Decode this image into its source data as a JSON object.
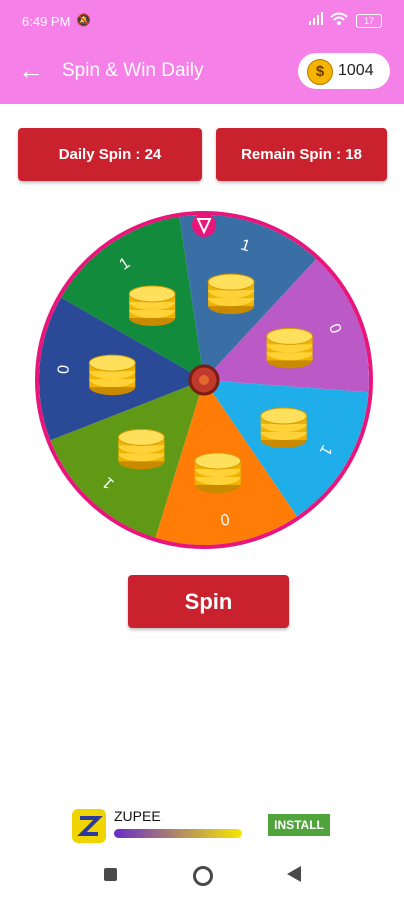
{
  "status_bar": {
    "time": "6:49 PM",
    "battery": "17"
  },
  "app_bar": {
    "title": "Spin & Win Daily",
    "coin_symbol": "$",
    "coins": "1004"
  },
  "stats": {
    "daily": "Daily Spin : 24",
    "remain": "Remain Spin : 18"
  },
  "wheel": {
    "segments": [
      {
        "label": "1",
        "color": "#128c3c"
      },
      {
        "label": "1",
        "color": "#3a6fa5"
      },
      {
        "label": "0",
        "color": "#bb59c6"
      },
      {
        "label": "1",
        "color": "#1faeea"
      },
      {
        "label": "0",
        "color": "#ff7d06"
      },
      {
        "label": "1",
        "color": "#5f9916"
      },
      {
        "label": "0",
        "color": "#2a4996"
      }
    ],
    "rim_color": "#e8167a"
  },
  "spin_button": {
    "label": "Spin"
  },
  "ad": {
    "name": "ZUPEE",
    "install": "INSTALL"
  }
}
